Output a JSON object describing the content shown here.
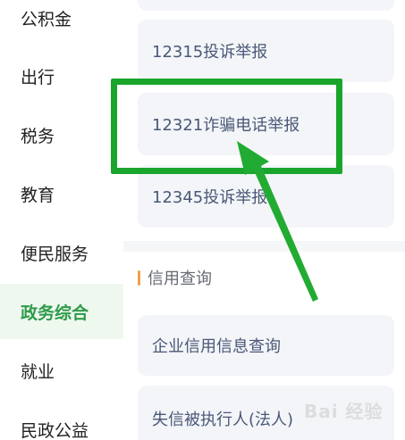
{
  "sidebar": {
    "items": [
      {
        "label": "公积金",
        "active": false
      },
      {
        "label": "出行",
        "active": false
      },
      {
        "label": "税务",
        "active": false
      },
      {
        "label": "教育",
        "active": false
      },
      {
        "label": "便民服务",
        "active": false
      },
      {
        "label": "政务综合",
        "active": true
      },
      {
        "label": "就业",
        "active": false
      },
      {
        "label": "民政公益",
        "active": false
      }
    ]
  },
  "complaints": {
    "items": [
      {
        "label": "12315投诉举报"
      },
      {
        "label": "12321诈骗电话举报"
      },
      {
        "label": "12345投诉举报"
      }
    ]
  },
  "credit": {
    "title": "信用查询",
    "items": [
      {
        "label": "企业信用信息查询"
      },
      {
        "label": "失信被执行人(法人)"
      }
    ]
  },
  "watermark": "Bai 经验",
  "colors": {
    "accent_green": "#2e9a4a",
    "highlight_green": "#1aa52d",
    "section_bar": "#f0a24a",
    "card_text": "#4a5877"
  }
}
